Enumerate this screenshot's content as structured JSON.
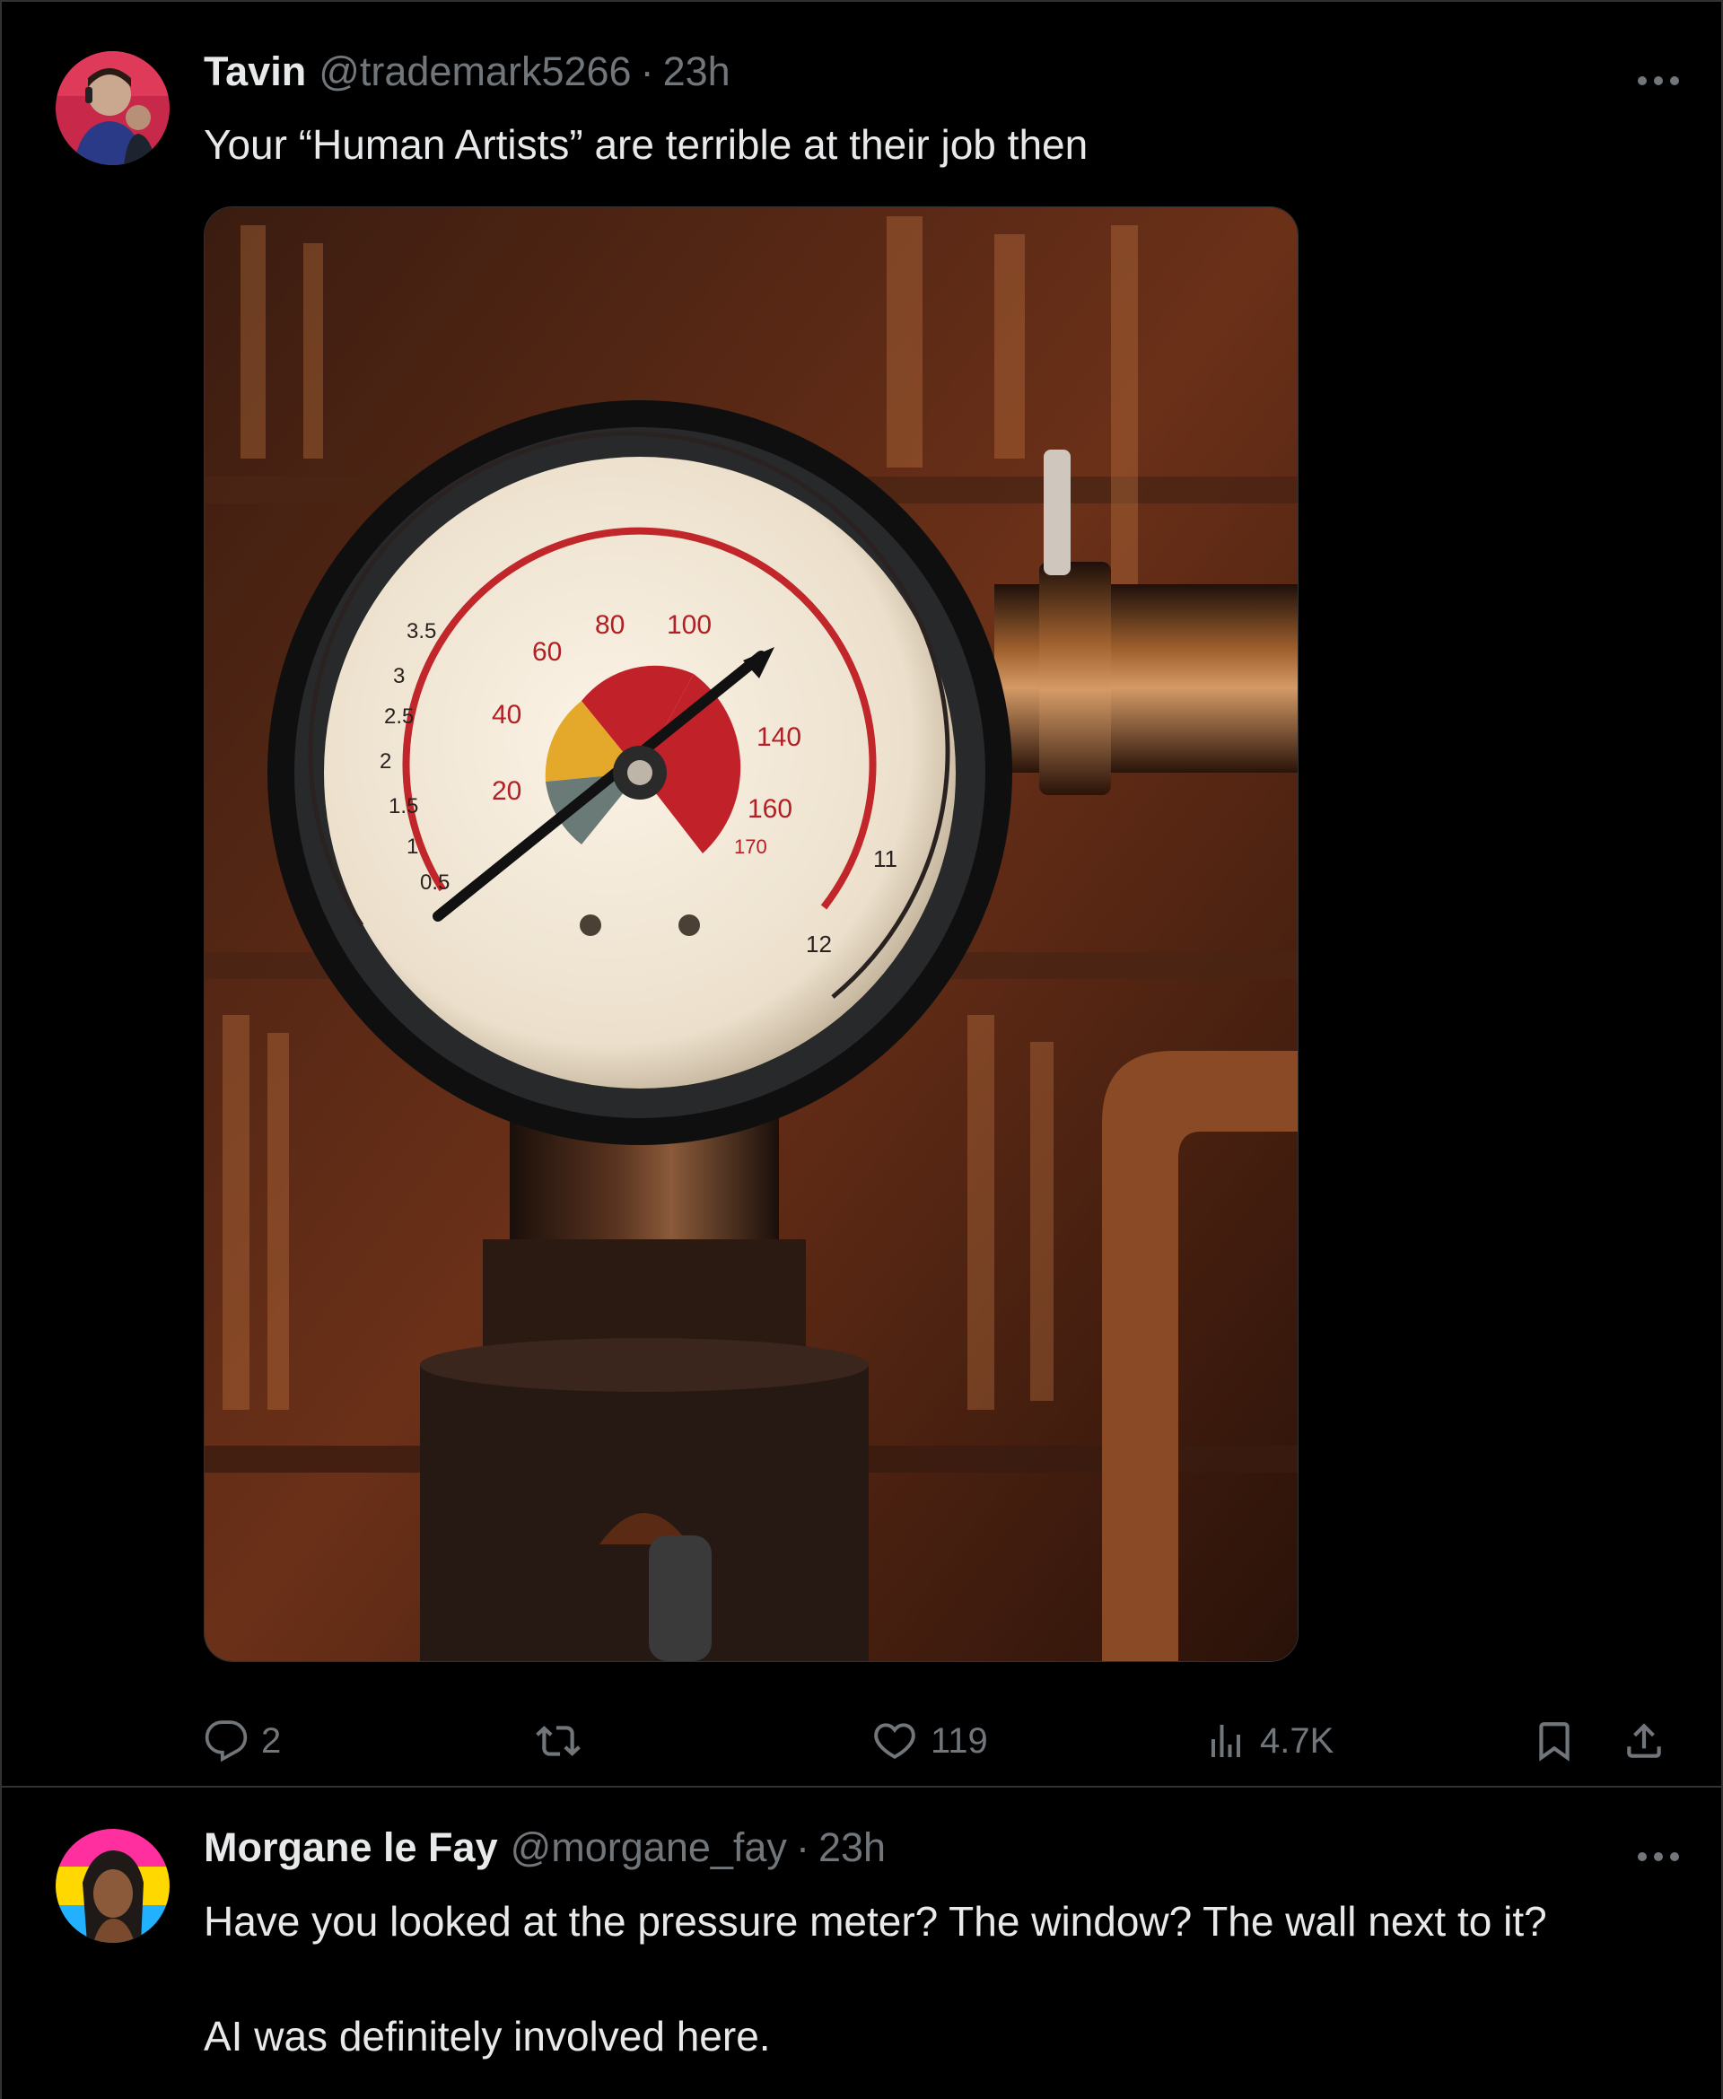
{
  "tweet1": {
    "author_name": "Tavin",
    "handle": "@trademark5266",
    "separator": "·",
    "time": "23h",
    "text": "Your “Human Artists” are terrible at their job then",
    "image_gauge_labels": [
      "0.5",
      "1",
      "1.5",
      "2",
      "2.5",
      "3",
      "3.5",
      "20",
      "40",
      "60",
      "80",
      "100",
      "140",
      "160",
      "170",
      "11",
      "12"
    ],
    "actions": {
      "reply_count": "2",
      "retweet_count": "",
      "like_count": "119",
      "views_count": "4.7K"
    }
  },
  "tweet2": {
    "author_name": "Morgane le Fay",
    "handle": "@morgane_fay",
    "separator": "·",
    "time": "23h",
    "text_line1": "Have you looked at the pressure meter? The window? The wall next to it?",
    "text_line2": "AI was definitely involved here."
  },
  "colors": {
    "background": "#000000",
    "text_primary": "#e7e9ea",
    "text_secondary": "#71767b",
    "border": "#2f3336"
  }
}
